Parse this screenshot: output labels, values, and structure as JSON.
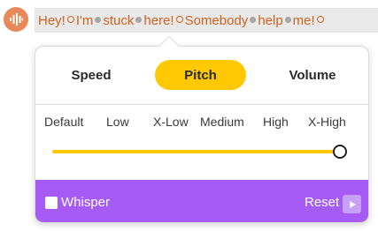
{
  "ssml_text": {
    "words": [
      "Hey!",
      "I'm",
      "stuck",
      "here!",
      "Somebody",
      "help",
      "me!"
    ],
    "breaks": [
      "strong",
      "soft",
      "soft",
      "strong",
      "soft",
      "soft",
      "strong"
    ]
  },
  "prosody_panel": {
    "tabs": [
      {
        "label": "Speed",
        "active": false
      },
      {
        "label": "Pitch",
        "active": true
      },
      {
        "label": "Volume",
        "active": false
      }
    ],
    "levels": [
      "Default",
      "Low",
      "X-Low",
      "Medium",
      "High",
      "X-High"
    ],
    "selected_level": "X-High",
    "slider_fraction": 1.0
  },
  "footer": {
    "whisper_label": "Whisper",
    "whisper_checked": false,
    "reset_label": "Reset"
  },
  "colors": {
    "voice_icon": "#e8895b",
    "text": "#d0621f",
    "text_bar_bg": "#e9e9e9",
    "tab_active": "#ffc800",
    "slider": "#ffc800",
    "footer_bg": "#a65cf4",
    "play_button_bg": "#c8a1f7"
  },
  "icons": {
    "voice": "sound-wave-icon",
    "play": "play-icon"
  }
}
